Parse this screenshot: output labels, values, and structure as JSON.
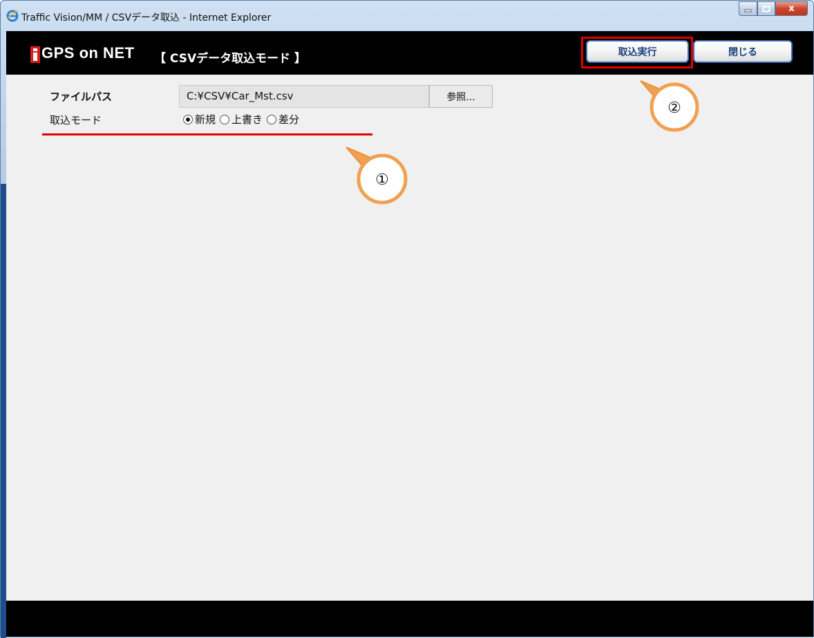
{
  "window": {
    "title": "Traffic Vision/MM / CSVデータ取込 - Internet Explorer",
    "close_glyph": "x"
  },
  "header": {
    "logo_text": "GPS on NET",
    "mode_title": "【 CSVデータ取込モード 】",
    "exec_button": "取込実行",
    "close_button": "閉じる"
  },
  "form": {
    "file_path_label": "ファイルパス",
    "file_path_value": "C:¥CSV¥Car_Mst.csv",
    "browse_button": "参照...",
    "mode_label": "取込モード",
    "modes": [
      {
        "label": "新規",
        "checked": true
      },
      {
        "label": "上書き",
        "checked": false
      },
      {
        "label": "差分",
        "checked": false
      }
    ]
  },
  "annotations": {
    "callout_1": "①",
    "callout_2": "②",
    "highlight_color": "#e00000",
    "callout_color": "#f0a050"
  }
}
